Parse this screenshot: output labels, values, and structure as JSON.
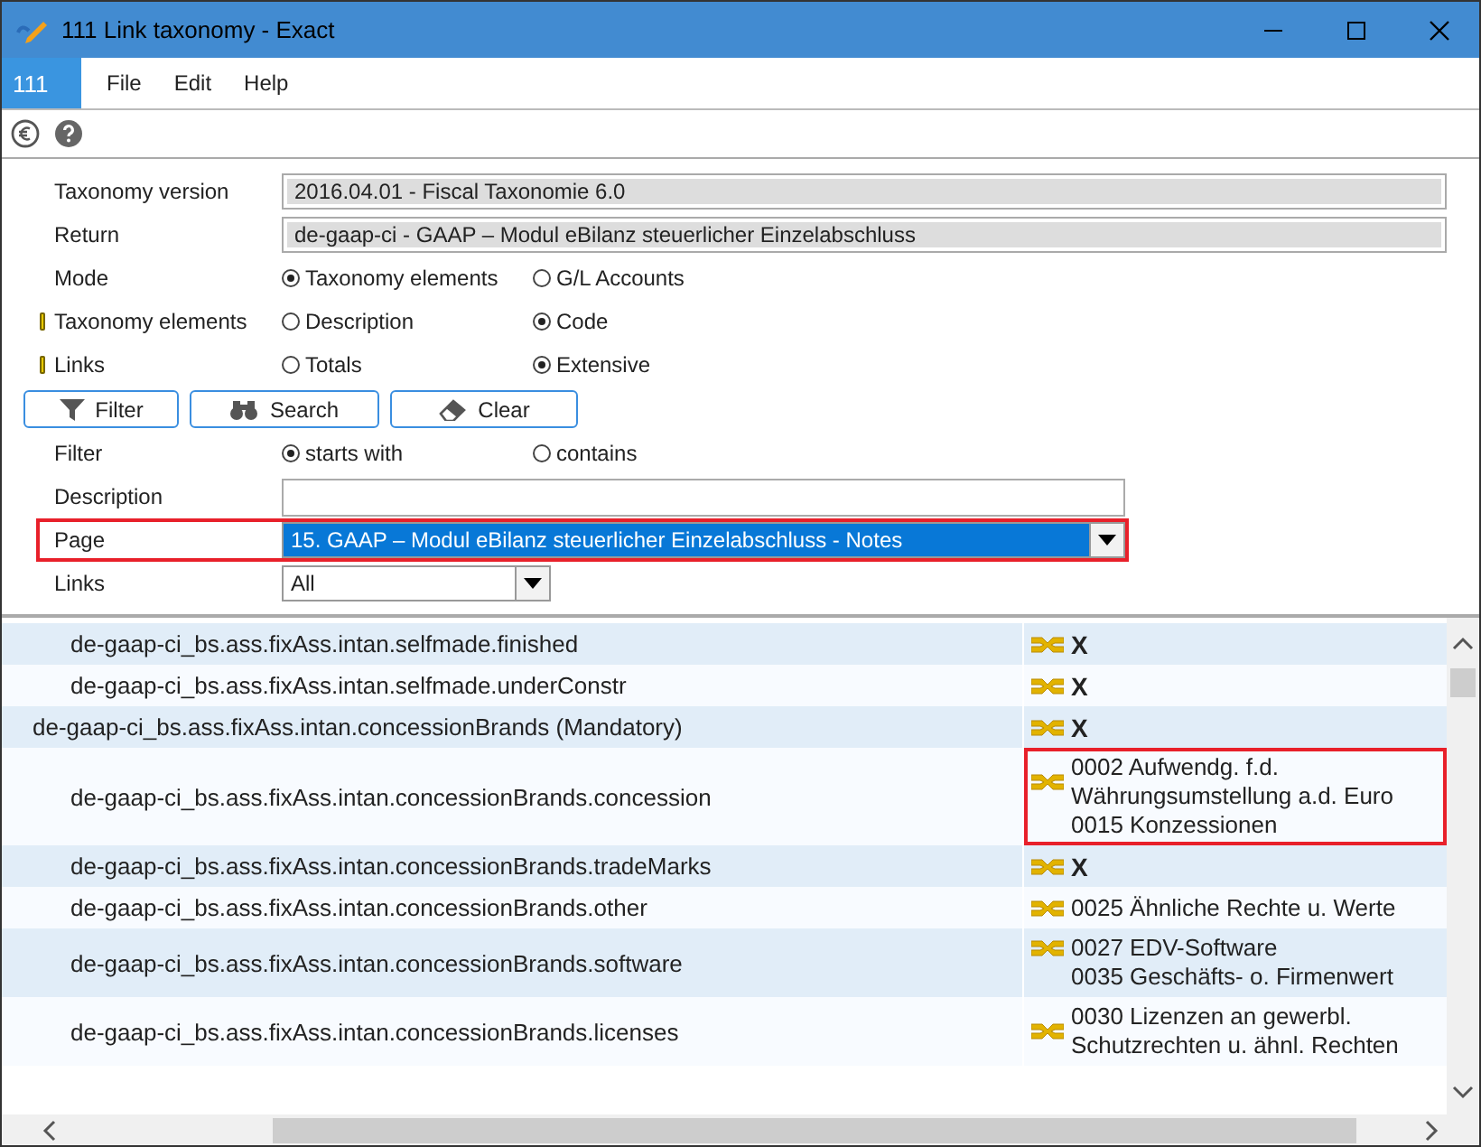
{
  "window": {
    "title": "111 Link taxonomy - Exact"
  },
  "menu": {
    "badge": "111",
    "items": [
      "File",
      "Edit",
      "Help"
    ]
  },
  "form": [
    {
      "kind": "readonly",
      "label": "Taxonomy version",
      "value": "2016.04.01 - Fiscal Taxonomie 6.0",
      "marker": false
    },
    {
      "kind": "readonly",
      "label": "Return",
      "value": "de-gaap-ci - GAAP – Modul eBilanz steuerlicher Einzelabschluss",
      "marker": false
    },
    {
      "kind": "radios",
      "label": "Mode",
      "marker": false,
      "options": [
        {
          "label": "Taxonomy elements",
          "selected": true
        },
        {
          "label": "G/L Accounts",
          "selected": false
        }
      ]
    },
    {
      "kind": "radios",
      "label": "Taxonomy elements",
      "marker": true,
      "options": [
        {
          "label": "Description",
          "selected": false
        },
        {
          "label": "Code",
          "selected": true
        }
      ]
    },
    {
      "kind": "radios",
      "label": "Links",
      "marker": true,
      "options": [
        {
          "label": "Totals",
          "selected": false
        },
        {
          "label": "Extensive",
          "selected": true
        }
      ]
    },
    {
      "kind": "buttons",
      "buttons": [
        {
          "label": "Filter"
        },
        {
          "label": "Search"
        },
        {
          "label": "Clear"
        }
      ]
    },
    {
      "kind": "radios",
      "label": "Filter",
      "marker": false,
      "options": [
        {
          "label": "starts with",
          "selected": true
        },
        {
          "label": "contains",
          "selected": false
        }
      ]
    },
    {
      "kind": "text",
      "label": "Description",
      "marker": false
    },
    {
      "kind": "select",
      "label": "Page",
      "value": "15.  GAAP – Modul eBilanz steuerlicher Einzelabschluss - Notes",
      "marker": false,
      "highlighted": true,
      "wide": true
    },
    {
      "kind": "select",
      "label": "Links",
      "value": "All",
      "marker": false,
      "highlighted": false,
      "wide": false
    }
  ],
  "grid": {
    "rows": [
      {
        "kind": "child",
        "element": "de-gaap-ci_bs.ass.fixAss.intan.selfmade.finished",
        "highlighted": false,
        "links": [
          "X"
        ]
      },
      {
        "kind": "child",
        "element": "de-gaap-ci_bs.ass.fixAss.intan.selfmade.underConstr",
        "highlighted": false,
        "links": [
          "X"
        ]
      },
      {
        "kind": "parent",
        "element": "de-gaap-ci_bs.ass.fixAss.intan.concessionBrands (Mandatory)",
        "highlighted": false,
        "links": [
          "X"
        ]
      },
      {
        "kind": "child",
        "element": "de-gaap-ci_bs.ass.fixAss.intan.concessionBrands.concession",
        "highlighted": true,
        "links": [
          "0002 Aufwendg. f.d. Währungsumstellung a.d. Euro",
          "0015 Konzessionen"
        ]
      },
      {
        "kind": "child",
        "element": "de-gaap-ci_bs.ass.fixAss.intan.concessionBrands.tradeMarks",
        "highlighted": false,
        "links": [
          "X"
        ]
      },
      {
        "kind": "child",
        "element": "de-gaap-ci_bs.ass.fixAss.intan.concessionBrands.other",
        "highlighted": false,
        "links": [
          "0025 Ähnliche Rechte u. Werte"
        ]
      },
      {
        "kind": "child",
        "element": "de-gaap-ci_bs.ass.fixAss.intan.concessionBrands.software",
        "highlighted": false,
        "links": [
          "0027 EDV-Software",
          "0035 Geschäfts- o. Firmenwert"
        ]
      },
      {
        "kind": "child",
        "element": "de-gaap-ci_bs.ass.fixAss.intan.concessionBrands.licenses",
        "highlighted": false,
        "links": [
          "0030 Lizenzen an gewerbl. Schutzrechten u. ähnl. Rechten"
        ]
      }
    ]
  }
}
